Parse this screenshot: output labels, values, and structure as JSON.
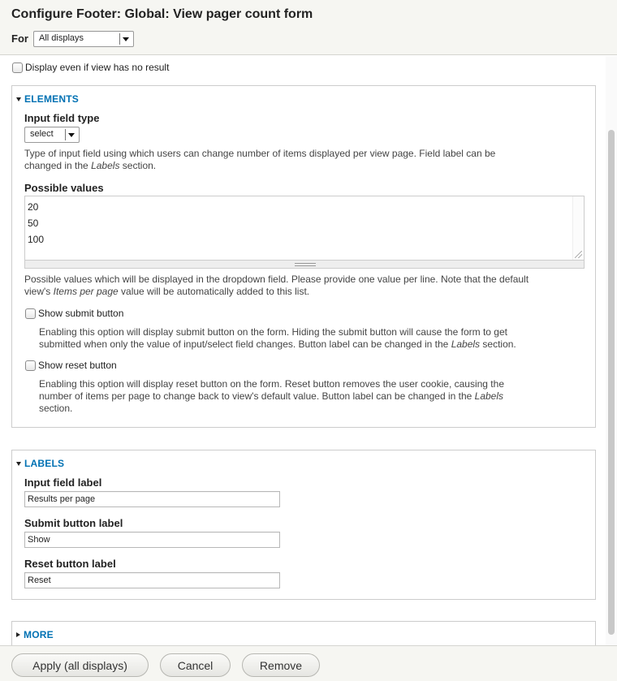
{
  "header": {
    "title": "Configure Footer: Global: View pager count form",
    "for_label": "For",
    "for_select_value": "All displays"
  },
  "display_empty": {
    "label": "Display even if view has no result",
    "checked": false
  },
  "elements": {
    "legend": "ELEMENTS",
    "input_field_type_label": "Input field type",
    "input_field_type_value": "select",
    "input_field_type_desc_1": "Type of input field using which users can change number of items displayed per view page. Field label can be",
    "input_field_type_desc_2a": "changed in the ",
    "input_field_type_desc_2b": "Labels",
    "input_field_type_desc_2c": " section.",
    "possible_values_label": "Possible values",
    "possible_values": [
      "20",
      "50",
      "100"
    ],
    "possible_values_desc_1": "Possible values which will be displayed in the dropdown field. Please provide one value per line. Note that the default",
    "possible_values_desc_2a": "view's ",
    "possible_values_desc_2b": "Items per page",
    "possible_values_desc_2c": " value will be automatically added to this list.",
    "show_submit_label": "Show submit button",
    "show_submit_desc_1": "Enabling this option will display submit button on the form. Hiding the submit button will cause the form to get",
    "show_submit_desc_2a": "submitted when only the value of input/select field changes. Button label can be changed in the ",
    "show_submit_desc_2b": "Labels",
    "show_submit_desc_2c": " section.",
    "show_reset_label": "Show reset button",
    "show_reset_desc_1": "Enabling this option will display reset button on the form. Reset button removes the user cookie, causing the",
    "show_reset_desc_2a": "number of items per page to change back to view's default value. Button label can be changed in the ",
    "show_reset_desc_2b": "Labels",
    "show_reset_desc_3": "section."
  },
  "labels": {
    "legend": "LABELS",
    "input_field_label": "Input field label",
    "input_field_value": "Results per page",
    "submit_button_label": "Submit button label",
    "submit_button_value": "Show",
    "reset_button_label": "Reset button label",
    "reset_button_value": "Reset"
  },
  "more": {
    "legend": "MORE"
  },
  "footer": {
    "apply": "Apply (all displays)",
    "cancel": "Cancel",
    "remove": "Remove"
  },
  "colors": {
    "accent": "#0071b3",
    "header_bg": "#f6f6f2"
  }
}
